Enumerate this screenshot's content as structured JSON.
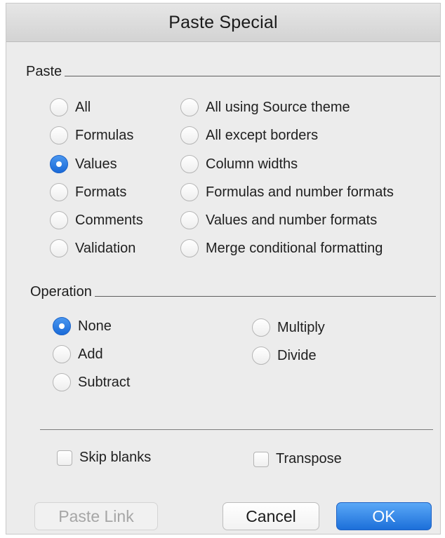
{
  "dialog": {
    "title": "Paste Special"
  },
  "paste": {
    "heading": "Paste",
    "left_options": [
      {
        "label": "All",
        "selected": false
      },
      {
        "label": "Formulas",
        "selected": false
      },
      {
        "label": "Values",
        "selected": true
      },
      {
        "label": "Formats",
        "selected": false
      },
      {
        "label": "Comments",
        "selected": false
      },
      {
        "label": "Validation",
        "selected": false
      }
    ],
    "right_options": [
      {
        "label": "All using Source theme",
        "selected": false
      },
      {
        "label": "All except borders",
        "selected": false
      },
      {
        "label": "Column widths",
        "selected": false
      },
      {
        "label": "Formulas and number formats",
        "selected": false
      },
      {
        "label": "Values and number formats",
        "selected": false
      },
      {
        "label": "Merge conditional formatting",
        "selected": false
      }
    ]
  },
  "operation": {
    "heading": "Operation",
    "left_options": [
      {
        "label": "None",
        "selected": true
      },
      {
        "label": "Add",
        "selected": false
      },
      {
        "label": "Subtract",
        "selected": false
      }
    ],
    "right_options": [
      {
        "label": "Multiply",
        "selected": false
      },
      {
        "label": "Divide",
        "selected": false
      }
    ]
  },
  "checkboxes": {
    "skip_blanks": {
      "label": "Skip blanks",
      "checked": false
    },
    "transpose": {
      "label": "Transpose",
      "checked": false
    }
  },
  "buttons": {
    "paste_link": "Paste Link",
    "cancel": "Cancel",
    "ok": "OK"
  },
  "colors": {
    "accent": "#1c6fd9",
    "dialog_bg": "#ececec",
    "disabled_text": "#a6a6a6"
  }
}
